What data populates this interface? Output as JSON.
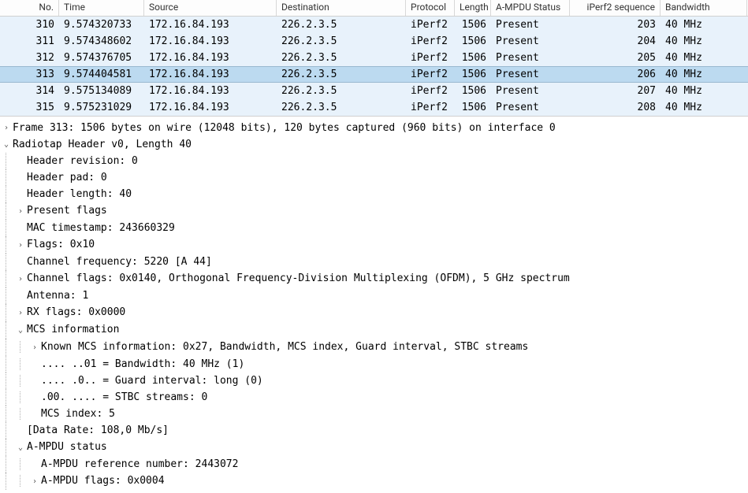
{
  "columns": [
    {
      "key": "no",
      "label": "No."
    },
    {
      "key": "time",
      "label": "Time"
    },
    {
      "key": "src",
      "label": "Source"
    },
    {
      "key": "dst",
      "label": "Destination"
    },
    {
      "key": "proto",
      "label": "Protocol"
    },
    {
      "key": "len",
      "label": "Length"
    },
    {
      "key": "ampdu",
      "label": "A-MPDU Status"
    },
    {
      "key": "seq",
      "label": "iPerf2 sequence"
    },
    {
      "key": "bw",
      "label": "Bandwidth"
    }
  ],
  "rows": [
    {
      "no": "310",
      "time": "9.574320733",
      "src": "172.16.84.193",
      "dst": "226.2.3.5",
      "proto": "iPerf2",
      "len": "1506",
      "ampdu": "Present",
      "seq": "203",
      "bw": "40 MHz",
      "selected": false
    },
    {
      "no": "311",
      "time": "9.574348602",
      "src": "172.16.84.193",
      "dst": "226.2.3.5",
      "proto": "iPerf2",
      "len": "1506",
      "ampdu": "Present",
      "seq": "204",
      "bw": "40 MHz",
      "selected": false
    },
    {
      "no": "312",
      "time": "9.574376705",
      "src": "172.16.84.193",
      "dst": "226.2.3.5",
      "proto": "iPerf2",
      "len": "1506",
      "ampdu": "Present",
      "seq": "205",
      "bw": "40 MHz",
      "selected": false
    },
    {
      "no": "313",
      "time": "9.574404581",
      "src": "172.16.84.193",
      "dst": "226.2.3.5",
      "proto": "iPerf2",
      "len": "1506",
      "ampdu": "Present",
      "seq": "206",
      "bw": "40 MHz",
      "selected": true
    },
    {
      "no": "314",
      "time": "9.575134089",
      "src": "172.16.84.193",
      "dst": "226.2.3.5",
      "proto": "iPerf2",
      "len": "1506",
      "ampdu": "Present",
      "seq": "207",
      "bw": "40 MHz",
      "selected": false
    },
    {
      "no": "315",
      "time": "9.575231029",
      "src": "172.16.84.193",
      "dst": "226.2.3.5",
      "proto": "iPerf2",
      "len": "1506",
      "ampdu": "Present",
      "seq": "208",
      "bw": "40 MHz",
      "selected": false
    }
  ],
  "tree": [
    {
      "indent": 0,
      "twist": "right",
      "text": "Frame 313: 1506 bytes on wire (12048 bits), 120 bytes captured (960 bits) on interface 0"
    },
    {
      "indent": 0,
      "twist": "down",
      "text": "Radiotap Header v0, Length 40"
    },
    {
      "indent": 1,
      "twist": "none",
      "text": "Header revision: 0"
    },
    {
      "indent": 1,
      "twist": "none",
      "text": "Header pad: 0"
    },
    {
      "indent": 1,
      "twist": "none",
      "text": "Header length: 40"
    },
    {
      "indent": 1,
      "twist": "right",
      "text": "Present flags"
    },
    {
      "indent": 1,
      "twist": "none",
      "text": "MAC timestamp: 243660329"
    },
    {
      "indent": 1,
      "twist": "right",
      "text": "Flags: 0x10"
    },
    {
      "indent": 1,
      "twist": "none",
      "text": "Channel frequency: 5220 [A 44]"
    },
    {
      "indent": 1,
      "twist": "right",
      "text": "Channel flags: 0x0140, Orthogonal Frequency-Division Multiplexing (OFDM), 5 GHz spectrum"
    },
    {
      "indent": 1,
      "twist": "none",
      "text": "Antenna: 1"
    },
    {
      "indent": 1,
      "twist": "right",
      "text": "RX flags: 0x0000"
    },
    {
      "indent": 1,
      "twist": "down",
      "text": "MCS information"
    },
    {
      "indent": 2,
      "twist": "right",
      "text": "Known MCS information: 0x27, Bandwidth, MCS index, Guard interval, STBC streams"
    },
    {
      "indent": 2,
      "twist": "none",
      "text": ".... ..01 = Bandwidth: 40 MHz (1)"
    },
    {
      "indent": 2,
      "twist": "none",
      "text": ".... .0.. = Guard interval: long (0)"
    },
    {
      "indent": 2,
      "twist": "none",
      "text": ".00. .... = STBC streams: 0"
    },
    {
      "indent": 2,
      "twist": "none",
      "text": "MCS index: 5"
    },
    {
      "indent": 1,
      "twist": "none",
      "text": "[Data Rate: 108,0 Mb/s]"
    },
    {
      "indent": 1,
      "twist": "down",
      "text": "A-MPDU status"
    },
    {
      "indent": 2,
      "twist": "none",
      "text": "A-MPDU reference number: 2443072"
    },
    {
      "indent": 2,
      "twist": "right",
      "text": "A-MPDU flags: 0x0004"
    }
  ]
}
